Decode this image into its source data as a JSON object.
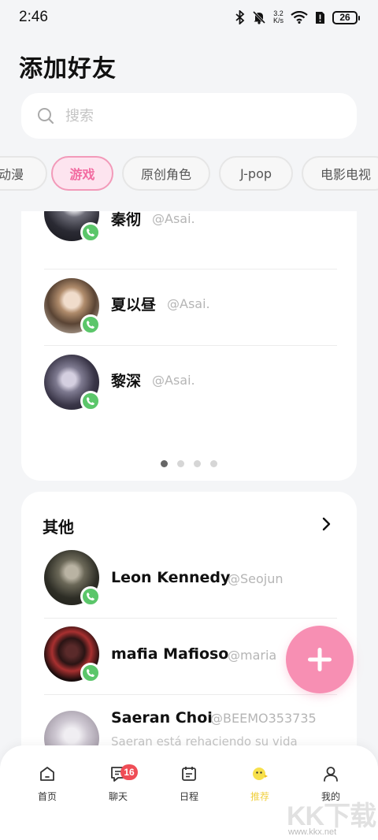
{
  "status_bar": {
    "time": "2:46",
    "net_speed_value": "3.2",
    "net_speed_unit": "K/s",
    "battery": "26"
  },
  "page_title": "添加好友",
  "search": {
    "placeholder": "搜索"
  },
  "categories": [
    {
      "label": "动漫",
      "active": false
    },
    {
      "label": "游戏",
      "active": true
    },
    {
      "label": "原创角色",
      "active": false
    },
    {
      "label": "J-pop",
      "active": false
    },
    {
      "label": "电影电视",
      "active": false
    }
  ],
  "featured": {
    "items": [
      {
        "name": "秦彻",
        "handle": "@Asai."
      },
      {
        "name": "夏以昼",
        "handle": "@Asai."
      },
      {
        "name": "黎深",
        "handle": "@Asai."
      }
    ],
    "pager": {
      "total": 4,
      "current": 1
    }
  },
  "other": {
    "title": "其他",
    "items": [
      {
        "name": "Leon Kennedy",
        "handle": "@Seojun",
        "subtext": ""
      },
      {
        "name": "mafia Mafioso",
        "handle": "@maria",
        "subtext": ""
      },
      {
        "name": "Saeran Choi",
        "handle": "@BEEMO353735",
        "subtext": "Saeran está rehaciendo su vida"
      }
    ]
  },
  "bottom_nav": [
    {
      "label": "首页",
      "icon": "home-icon",
      "active": false
    },
    {
      "label": "聊天",
      "icon": "chat-icon",
      "active": false,
      "badge": "16"
    },
    {
      "label": "日程",
      "icon": "calendar-icon",
      "active": false
    },
    {
      "label": "推荐",
      "icon": "recommend-icon",
      "active": true
    },
    {
      "label": "我的",
      "icon": "profile-icon",
      "active": false
    }
  ],
  "watermark": {
    "logo": "KK下载",
    "url": "www.kkx.net"
  },
  "colors": {
    "accent_pink": "#f78fb3",
    "chip_active_text": "#f26aa0",
    "call_green": "#5bc66a",
    "badge_red": "#ef4d56",
    "nav_active": "#f0d040"
  }
}
